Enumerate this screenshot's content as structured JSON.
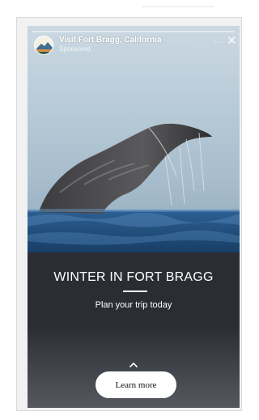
{
  "ad": {
    "account_name": "Visit Fort Bragg, California",
    "sponsored_label": "Sponsored",
    "more_icon": "more-icon",
    "close_icon": "close-icon",
    "more_glyph": "···",
    "close_glyph": "✕",
    "progress": 0
  },
  "content": {
    "headline": "WINTER IN FORT BRAGG",
    "subhead": "Plan your trip today"
  },
  "cta": {
    "chevron_icon": "chevron-up-icon",
    "label": "Learn more"
  },
  "colors": {
    "background": "#2a2d33",
    "text": "#ffffff",
    "button": "#ffffff",
    "button_text": "#111111"
  }
}
